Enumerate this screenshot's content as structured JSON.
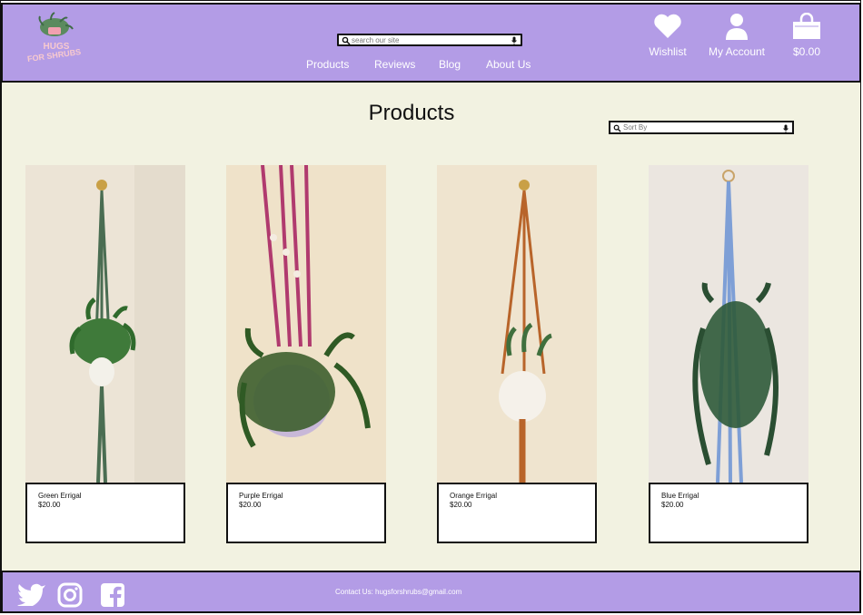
{
  "brand": {
    "line1": "HUGS",
    "line2": "FOR SHRUBS"
  },
  "search": {
    "placeholder": "search our site"
  },
  "nav": {
    "items": [
      "Products",
      "Reviews",
      "Blog",
      "About Us"
    ]
  },
  "header_actions": {
    "wishlist": "Wishlist",
    "account": "My Account",
    "cart_total": "$0.00"
  },
  "page": {
    "title": "Products",
    "sort_placeholder": "Sort By"
  },
  "products": [
    {
      "name": "Green Errigal",
      "price": "$20.00",
      "cord_color": "#4a6d52"
    },
    {
      "name": "Purple Errigal",
      "price": "$20.00",
      "cord_color": "#b03a6e"
    },
    {
      "name": "Orange Errigal",
      "price": "$20.00",
      "cord_color": "#b8642a"
    },
    {
      "name": "Blue Errigal",
      "price": "$20.00",
      "cord_color": "#7e9fd6"
    }
  ],
  "footer": {
    "contact": "Contact Us: hugsforshrubs@gmail.com"
  },
  "colors": {
    "header_bg": "#b39ce6",
    "main_bg": "#f2f2e1"
  }
}
